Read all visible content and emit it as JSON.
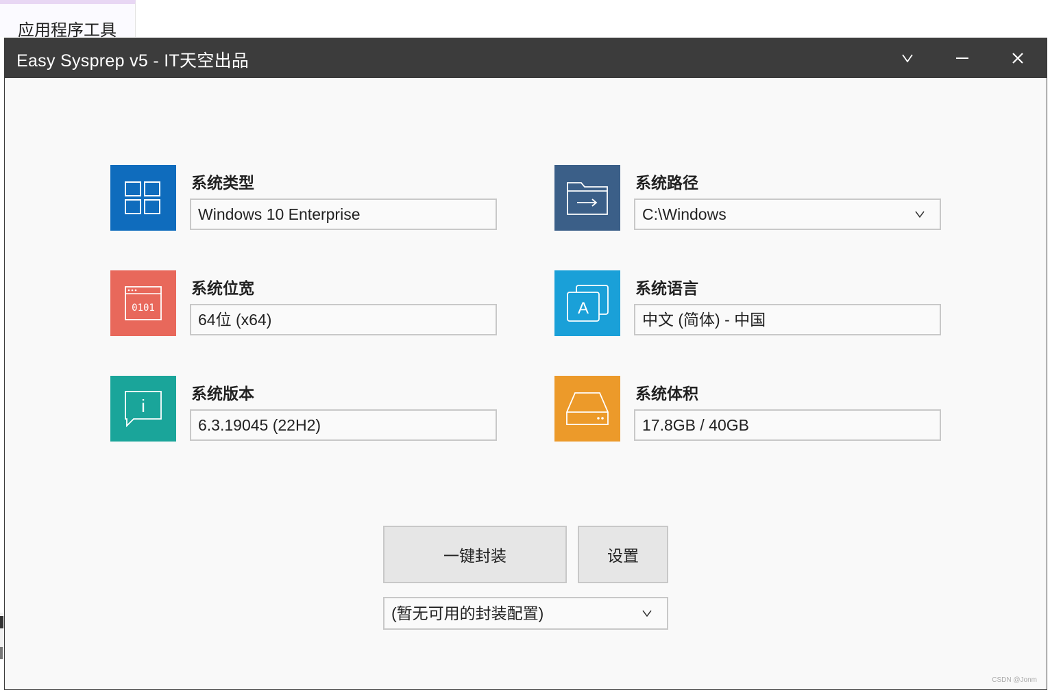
{
  "background_app": {
    "tab_label": "应用程序工具"
  },
  "window": {
    "title": "Easy Sysprep v5 - IT天空出品",
    "controls": {
      "menu": "dropdown",
      "minimize": "minimize",
      "close": "close"
    }
  },
  "fields": {
    "os_type": {
      "label": "系统类型",
      "value": "Windows 10 Enterprise",
      "icon": "windows-grid-icon",
      "color": "#0f6cbd"
    },
    "os_path": {
      "label": "系统路径",
      "value": "C:\\Windows",
      "icon": "folder-arrow-icon",
      "color": "#3b5f88"
    },
    "os_arch": {
      "label": "系统位宽",
      "value": "64位 (x64)",
      "icon": "binary-window-icon",
      "color": "#e8685b",
      "icon_text": "0101"
    },
    "os_lang": {
      "label": "系统语言",
      "value": "中文 (简体) - 中国",
      "icon": "language-icon",
      "color": "#1aa0d8",
      "icon_text": "A"
    },
    "os_version": {
      "label": "系统版本",
      "value": "6.3.19045 (22H2)",
      "icon": "info-bubble-icon",
      "color": "#1aa59a",
      "icon_text": "i"
    },
    "os_size": {
      "label": "系统体积",
      "value": "17.8GB / 40GB",
      "icon": "drive-icon",
      "color": "#ec9a2a"
    }
  },
  "actions": {
    "package_label": "一键封装",
    "settings_label": "设置",
    "config_value": "(暂无可用的封装配置)"
  },
  "watermark": "CSDN @Jonm"
}
